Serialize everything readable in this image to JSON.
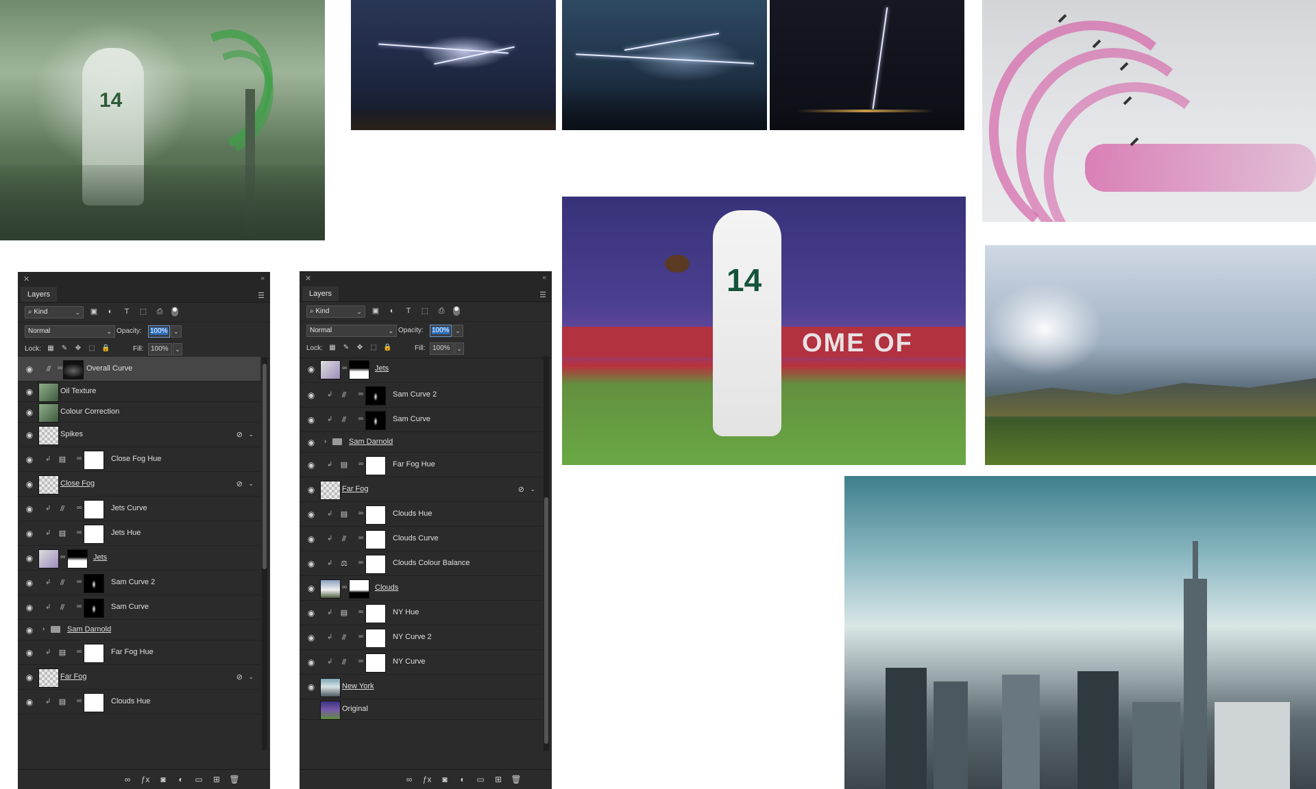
{
  "panels": [
    {
      "title": "Layers",
      "filter_kind": "Kind",
      "blend_mode": "Normal",
      "opacity_label": "Opacity:",
      "opacity_value": "100%",
      "lock_label": "Lock:",
      "fill_label": "Fill:",
      "fill_value": "100%",
      "layers": [
        {
          "name": "Overall Curve",
          "selected": true
        },
        {
          "name": "Oil Texture"
        },
        {
          "name": "Colour Correction"
        },
        {
          "name": "Spikes"
        },
        {
          "name": "Close Fog Hue"
        },
        {
          "name": "Close Fog"
        },
        {
          "name": "Jets Curve"
        },
        {
          "name": "Jets Hue"
        },
        {
          "name": "Jets"
        },
        {
          "name": "Sam Curve 2"
        },
        {
          "name": "Sam Curve"
        },
        {
          "name": "Sam Darnold"
        },
        {
          "name": "Far Fog Hue"
        },
        {
          "name": "Far Fog"
        },
        {
          "name": "Clouds Hue"
        }
      ]
    },
    {
      "title": "Layers",
      "filter_kind": "Kind",
      "blend_mode": "Normal",
      "opacity_label": "Opacity:",
      "opacity_value": "100%",
      "lock_label": "Lock:",
      "fill_label": "Fill:",
      "fill_value": "100%",
      "layers": [
        {
          "name": "Jets"
        },
        {
          "name": "Sam Curve 2"
        },
        {
          "name": "Sam Curve"
        },
        {
          "name": "Sam Darnold"
        },
        {
          "name": "Far Fog Hue"
        },
        {
          "name": "Far Fog"
        },
        {
          "name": "Clouds Hue"
        },
        {
          "name": "Clouds Curve"
        },
        {
          "name": "Clouds Colour Balance"
        },
        {
          "name": "Clouds"
        },
        {
          "name": "NY Hue"
        },
        {
          "name": "NY Curve 2"
        },
        {
          "name": "NY Curve"
        },
        {
          "name": "New York"
        },
        {
          "name": "Original",
          "visible": false
        }
      ]
    }
  ],
  "photos": {
    "hero_jersey": "14",
    "player_jersey": "14",
    "banner_text": "OME OF"
  },
  "icons": {
    "eye": "eye-icon",
    "curves": "curves-icon",
    "hue": "hue-saturation-icon",
    "balance": "color-balance-icon",
    "link": "link-icon",
    "clip": "clipping-arrow-icon",
    "folder": "folder-icon",
    "smart": "smart-object-icon",
    "fx": "effects-icon"
  },
  "colors": {
    "panel_bg": "#2b2b2b",
    "selection": "#464646",
    "accent": "#2b6dbd"
  }
}
